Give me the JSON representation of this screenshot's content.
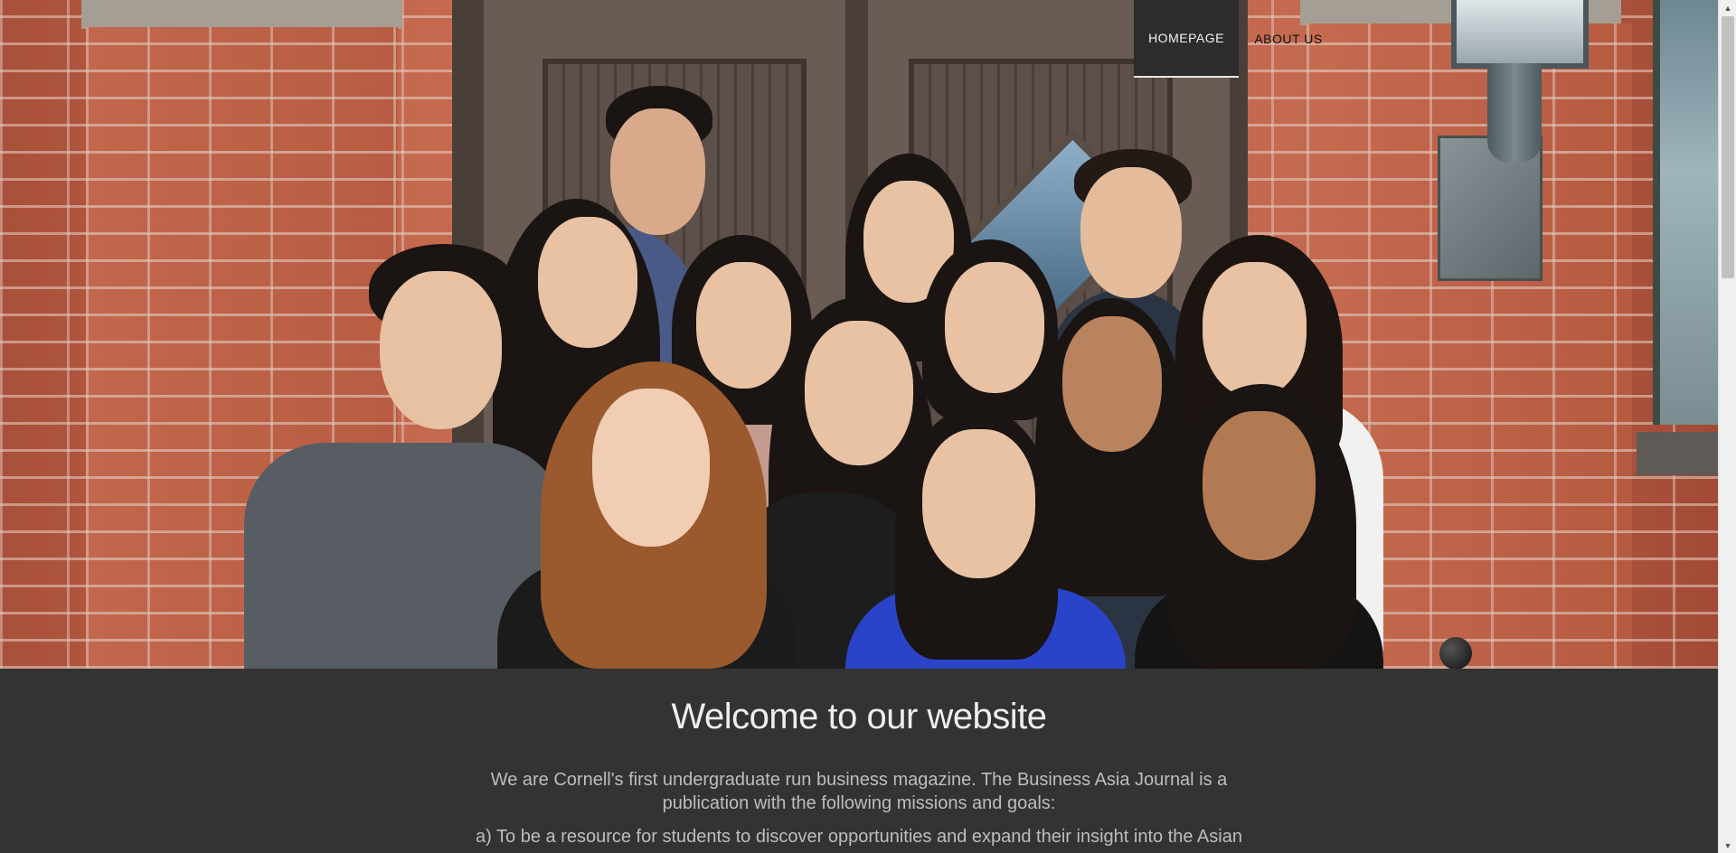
{
  "nav": {
    "items": [
      {
        "label": "HOMEPAGE",
        "active": true
      },
      {
        "label": "ABOUT US",
        "active": false
      }
    ]
  },
  "hero": {
    "image_alt": "Group photo of the Business Asia Journal team in front of a brick building doorway"
  },
  "main": {
    "heading": "Welcome to our website",
    "intro": "We are Cornell's first undergraduate run business magazine. The Business Asia Journal is a publication with the following missions and goals:",
    "mission_a": "a) To be a resource for students to discover opportunities and expand their insight into the Asian"
  },
  "scrollbar": {
    "up_icon": "triangle-up",
    "down_icon": "triangle-down"
  },
  "colors": {
    "content_bg": "#333333",
    "heading": "#eeeeee",
    "body_text": "#bdbdbd",
    "nav_active_bg": "#2c2c2c"
  }
}
